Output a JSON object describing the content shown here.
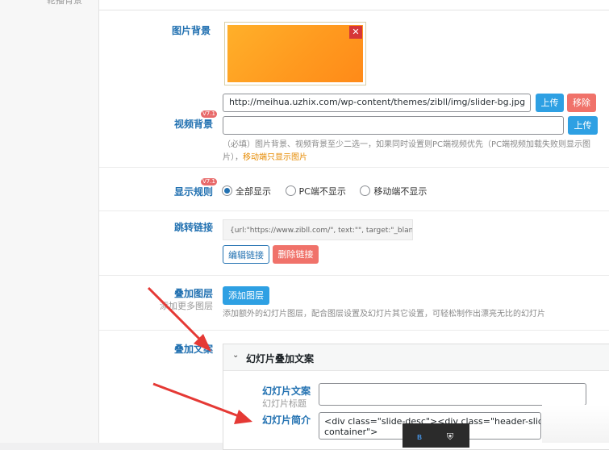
{
  "sidebar": {
    "top_item": "轮播背景"
  },
  "image_bg": {
    "label": "图片背景"
  },
  "video_bg": {
    "label": "视频背景",
    "badge": "V7.1",
    "url": "http://meihua.uzhix.com/wp-content/themes/zibll/img/slider-bg.jpg",
    "upload": "上传",
    "remove": "移除",
    "upload2": "上传",
    "desc_main": "（必填）图片背景、视频背景至少二选一，如果同时设置则PC端视频优先（PC端视频加载失败则显示图片），",
    "desc_warn": "移动端只显示图片"
  },
  "display_rule": {
    "label": "显示规则",
    "badge": "V7.1",
    "options": [
      "全部显示",
      "PC端不显示",
      "移动端不显示"
    ],
    "selected": "全部显示"
  },
  "jump_link": {
    "label": "跳转链接",
    "value": "{url:\"https://www.zibll.com/\", text:\"\", target:\"_blank\"}",
    "edit": "编辑链接",
    "delete": "删除链接"
  },
  "layers": {
    "label": "叠加图层",
    "sub": "添加更多图层",
    "add": "添加图层",
    "desc": "添加额外的幻灯片图层，配合图层设置及幻灯片其它设置，可轻松制作出漂亮无比的幻灯片"
  },
  "overlay_text": {
    "label": "叠加文案",
    "panel_title": "幻灯片叠加文案",
    "slide_text_label": "幻灯片文案",
    "slide_text_sub": "幻灯片标题",
    "slide_intro_label": "幻灯片简介",
    "intro_value": "<div class=\"slide-desc\"><div class=\"header-slider",
    "intro_value2": "container\">"
  },
  "colors": {
    "accent": "#2271b1",
    "blue_button": "#2ea0e3",
    "red_button": "#f0726a",
    "arrow": "#e53935"
  }
}
